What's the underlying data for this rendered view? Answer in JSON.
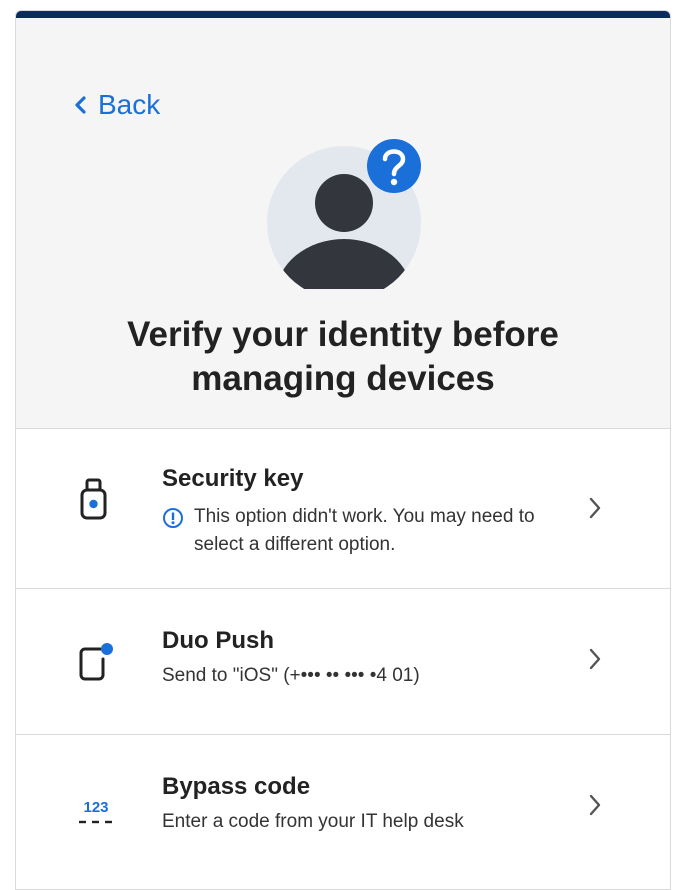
{
  "header": {
    "back_label": "Back",
    "title": "Verify your identity before managing devices"
  },
  "options": [
    {
      "title": "Security key",
      "icon": "security-key-icon",
      "warning": "This option didn't work. You may need to select a different option."
    },
    {
      "title": "Duo Push",
      "icon": "duo-push-icon",
      "subtitle": "Send to \"iOS\" (+••• •• ••• •4 01)"
    },
    {
      "title": "Bypass code",
      "icon": "bypass-code-icon",
      "icon_text": "123",
      "subtitle": "Enter a code from your IT help desk"
    }
  ],
  "colors": {
    "top_bar": "#0b2b5b",
    "accent": "#1a6fd8",
    "header_bg": "#f5f5f5",
    "text": "#222222"
  }
}
